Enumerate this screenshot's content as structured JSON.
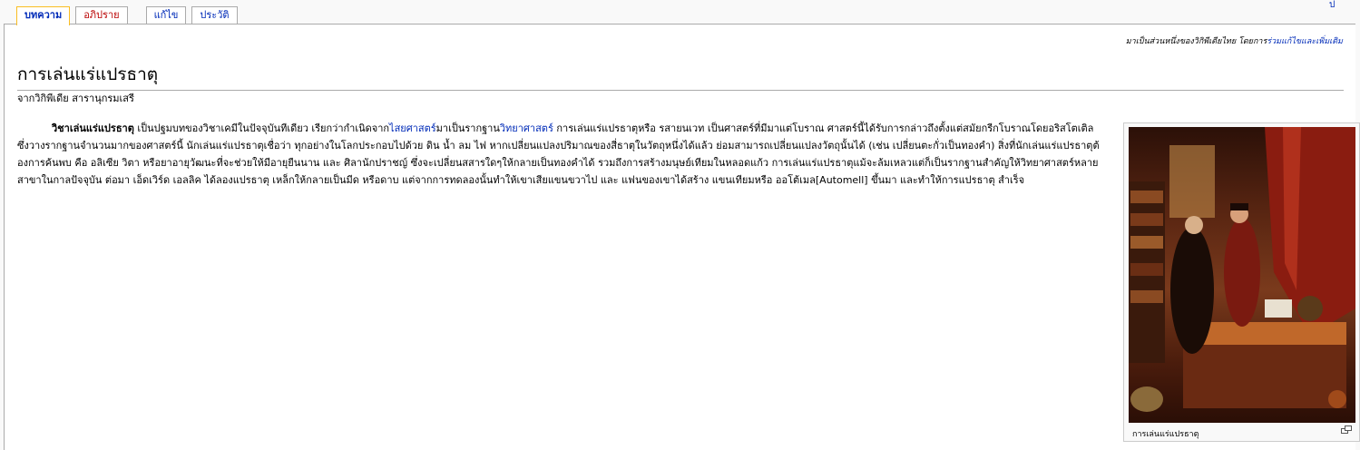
{
  "tabs": {
    "article": "บทความ",
    "discussion": "อภิปราย",
    "edit": "แก้ไข",
    "history": "ประวัติ"
  },
  "site_sub": {
    "text": "มาเป็นส่วนหนึ่งของวิกิพีเดียไทย โดยการ",
    "link": "ร่วมแก้ไขและเพิ่มเติม"
  },
  "title": "การเล่นแร่แปรธาตุ",
  "from": "จากวิกิพีเดีย สารานุกรมเสรี",
  "body": {
    "bold": "วิชาเล่นแร่แปรธาตุ",
    "t1": " เป็นปฐมบทของวิชาเคมีในปัจจุบันทีเดียว เรียกว่ากำเนิดจาก",
    "link1": "ไสยศาสตร์",
    "t2": "มาเป็นรากฐาน",
    "link2": "วิทยาศาสตร์",
    "t3": " การเล่นแร่แปรธาตุหรือ รสายนเวท เป็นศาสตร์ที่มีมาแต่โบราณ ศาสตร์นี้ได้รับการกล่าวถึงตั้งแต่สมัยกรีกโบราณโดยอริสโตเติล ซึ่งวางรากฐานจำนวนมากของศาสตร์นี้ นักเล่นแร่แปรธาตุเชื่อว่า ทุกอย่างในโลกประกอบไปด้วย ดิน น้ำ ลม ไฟ หากเปลี่ยนแปลงปริมาณของสี่ธาตุในวัตถุหนึ่งได้แล้ว ย่อมสามารถเปลี่ยนแปลงวัตถุนั้นได้ (เช่น เปลี่ยนตะกั่วเป็นทองคำ) สิ่งที่นักเล่นแร่แปรธาตุต้องการค้นพบ คือ อลิเซีย วิตา หรือยาอายุวัฒนะที่จะช่วยให้มีอายุยืนนาน และ ศิลานักปราชญ์ ซึ่งจะเปลี่ยนสสารใดๆให้กลายเป็นทองคำได้ รวมถึงการสร้างมนุษย์เทียมในหลอดแก้ว การเล่นแร่แปรธาตุแม้จะล้มเหลวแต่ก็เป็นรากฐานสำคัญให้วิทยาศาสตร์หลายสาขาในกาลปัจจุบัน ต่อมา เอ็ดเวิร์ด เอลลิค ได้ลองแปรธาตุ เหล็กให้กลายเป็นมีด หรือดาบ แต่จากการทดลองนั้นทำให้เขาเสียแขนขวาไป และ แฟนของเขาได้สร้าง แขนเทียมหรือ ออโต้เมล[Automell] ขึ้นมา และทำให้การแปรธาตุ สำเร็จ"
  },
  "thumb": {
    "caption": "การเล่นแร่แปรธาตุ"
  },
  "icons": {
    "magnify": "magnify-icon"
  }
}
